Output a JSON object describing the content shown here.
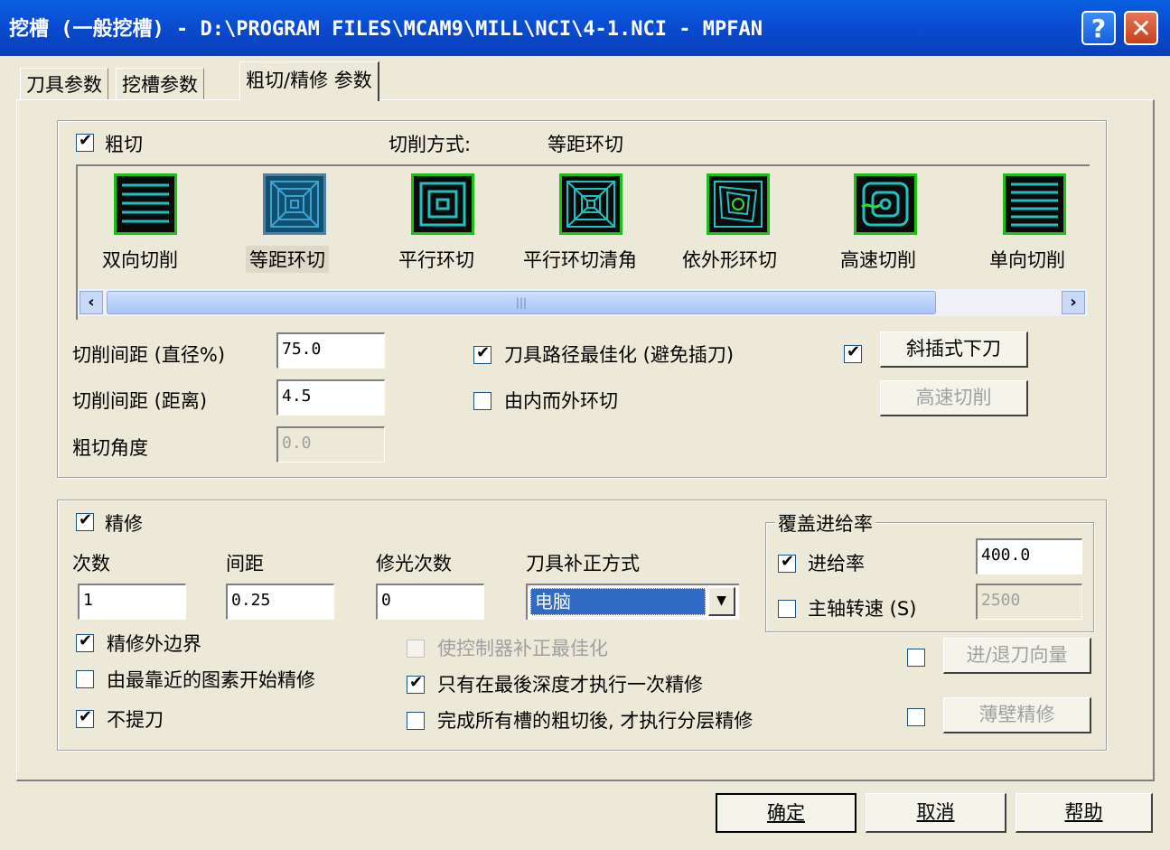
{
  "window": {
    "title": "挖槽 (一般挖槽) - D:\\PROGRAM FILES\\MCAM9\\MILL\\NCI\\4-1.NCI - MPFAN",
    "help_glyph": "?",
    "close_glyph": "✕"
  },
  "tabs": [
    {
      "label": "刀具参数"
    },
    {
      "label": "挖槽参数"
    },
    {
      "label": "粗切/精修 参数"
    }
  ],
  "rough": {
    "label": "粗切",
    "checked": true,
    "method_label": "切削方式:",
    "method_value": "等距环切",
    "methods": [
      {
        "label": "双向切削",
        "icon": "zigzag-icon"
      },
      {
        "label": "等距环切",
        "icon": "constant-overlap-spiral-icon",
        "selected": true
      },
      {
        "label": "平行环切",
        "icon": "parallel-spiral-icon"
      },
      {
        "label": "平行环切清角",
        "icon": "parallel-spiral-clean-corners-icon"
      },
      {
        "label": "依外形环切",
        "icon": "morph-spiral-icon"
      },
      {
        "label": "高速切削",
        "icon": "high-speed-icon"
      },
      {
        "label": "单向切削",
        "icon": "one-way-icon"
      }
    ],
    "stepover_pct_label": "切削间距 (直径%)",
    "stepover_pct": "75.0",
    "stepover_dist_label": "切削间距 (距离)",
    "stepover_dist": "4.5",
    "angle_label": "粗切角度",
    "angle": "0.0",
    "optimize_label": "刀具路径最佳化 (避免插刀)",
    "optimize_checked": true,
    "inside_out_label": "由内而外环切",
    "inside_out_checked": false,
    "helix_checked": true,
    "helix_button": "斜插式下刀",
    "high_speed_button": "高速切削"
  },
  "finish": {
    "label": "精修",
    "checked": true,
    "passes_label": "次数",
    "passes": "1",
    "spacing_label": "间距",
    "spacing": "0.25",
    "spring_label": "修光次数",
    "spring": "0",
    "comp_label": "刀具补正方式",
    "comp_value": "电脑",
    "override_title": "覆盖进给率",
    "feed_label": "进给率",
    "feed_checked": true,
    "feed_value": "400.0",
    "spindle_label": "主轴转速 (S)",
    "spindle_checked": false,
    "spindle_value": "2500",
    "outer_label": "精修外边界",
    "outer_checked": true,
    "nearest_label": "由最靠近的图素开始精修",
    "nearest_checked": false,
    "keep_tool_label": "不提刀",
    "keep_tool_checked": true,
    "opt_comp_label": "使控制器补正最佳化",
    "final_depth_label": "只有在最後深度才执行一次精修",
    "final_depth_checked": true,
    "after_rough_label": "完成所有槽的粗切後, 才执行分层精修",
    "after_rough_checked": false,
    "lead_button": "进/退刀向量",
    "thin_wall_button": "薄壁精修"
  },
  "footer": {
    "ok": "确定",
    "cancel": "取消",
    "help": "帮助"
  },
  "colors": {
    "titlebar": "#0a4ad0",
    "selection": "#316ac5",
    "icon_frame": "#18c018",
    "icon_line_cyan": "#20c0c0"
  }
}
